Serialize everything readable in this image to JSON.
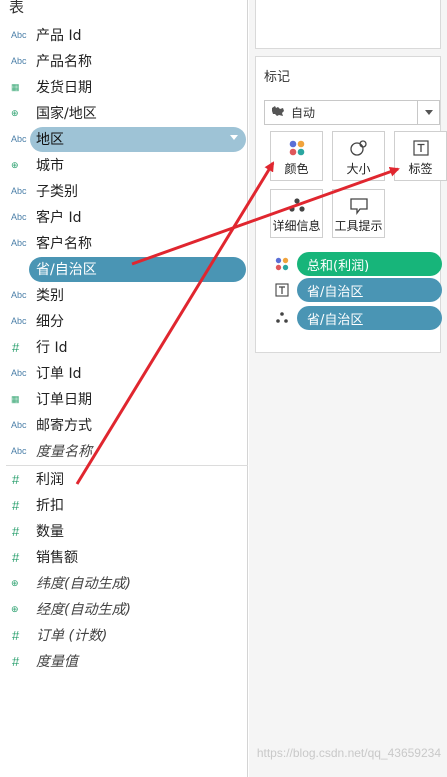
{
  "data_pane": {
    "title": "表",
    "dimensions": [
      {
        "icon": "Abc",
        "icon_name": "string-type-icon",
        "label": "产品 Id"
      },
      {
        "icon": "Abc",
        "icon_name": "string-type-icon",
        "label": "产品名称"
      },
      {
        "icon": "▦",
        "icon_name": "calendar-icon",
        "label": "发货日期"
      },
      {
        "icon": "⊕",
        "icon_name": "globe-icon",
        "label": "国家/地区"
      },
      {
        "icon": "Abc",
        "icon_name": "string-type-icon",
        "label": "地区"
      },
      {
        "icon": "⊕",
        "icon_name": "globe-icon",
        "label": "城市"
      },
      {
        "icon": "Abc",
        "icon_name": "string-type-icon",
        "label": "子类别"
      },
      {
        "icon": "Abc",
        "icon_name": "string-type-icon",
        "label": "客户 Id"
      },
      {
        "icon": "Abc",
        "icon_name": "string-type-icon",
        "label": "客户名称"
      },
      {
        "icon": "⊕",
        "icon_name": "globe-icon",
        "label": "省/自治区"
      },
      {
        "icon": "Abc",
        "icon_name": "string-type-icon",
        "label": "类别"
      },
      {
        "icon": "Abc",
        "icon_name": "string-type-icon",
        "label": "细分"
      },
      {
        "icon": "#",
        "icon_name": "number-type-icon",
        "label": "行 Id"
      },
      {
        "icon": "Abc",
        "icon_name": "string-type-icon",
        "label": "订单 Id"
      },
      {
        "icon": "▦",
        "icon_name": "calendar-icon",
        "label": "订单日期"
      },
      {
        "icon": "Abc",
        "icon_name": "string-type-icon",
        "label": "邮寄方式"
      },
      {
        "icon": "Abc",
        "icon_name": "string-type-icon",
        "label": "度量名称"
      }
    ],
    "measures": [
      {
        "icon": "#",
        "icon_name": "number-type-icon",
        "label": "利润"
      },
      {
        "icon": "#",
        "icon_name": "number-type-icon",
        "label": "折扣"
      },
      {
        "icon": "#",
        "icon_name": "number-type-icon",
        "label": "数量"
      },
      {
        "icon": "#",
        "icon_name": "number-type-icon",
        "label": "销售额"
      },
      {
        "icon": "⊕",
        "icon_name": "globe-icon",
        "label": "纬度(自动生成)"
      },
      {
        "icon": "⊕",
        "icon_name": "globe-icon",
        "label": "经度(自动生成)"
      },
      {
        "icon": "#",
        "icon_name": "number-type-icon",
        "label": "订单 (计数)"
      },
      {
        "icon": "#",
        "icon_name": "number-type-icon",
        "label": "度量值"
      }
    ]
  },
  "marks_card": {
    "title": "标记",
    "mark_type": "自动",
    "buttons": {
      "color": "颜色",
      "size": "大小",
      "label": "标签",
      "detail": "详细信息",
      "tooltip": "工具提示"
    },
    "shelves": {
      "color_field": "总和(利润)",
      "label_field": "省/自治区",
      "detail_field": "省/自治区"
    }
  },
  "watermark": "https://blog.csdn.net/qq_43659234",
  "colors": {
    "dimension_pill": "#4a95b4",
    "dimension_pill_light": "#9ec3d6",
    "measure_pill": "#17b57a",
    "arrow": "#e0262f"
  }
}
